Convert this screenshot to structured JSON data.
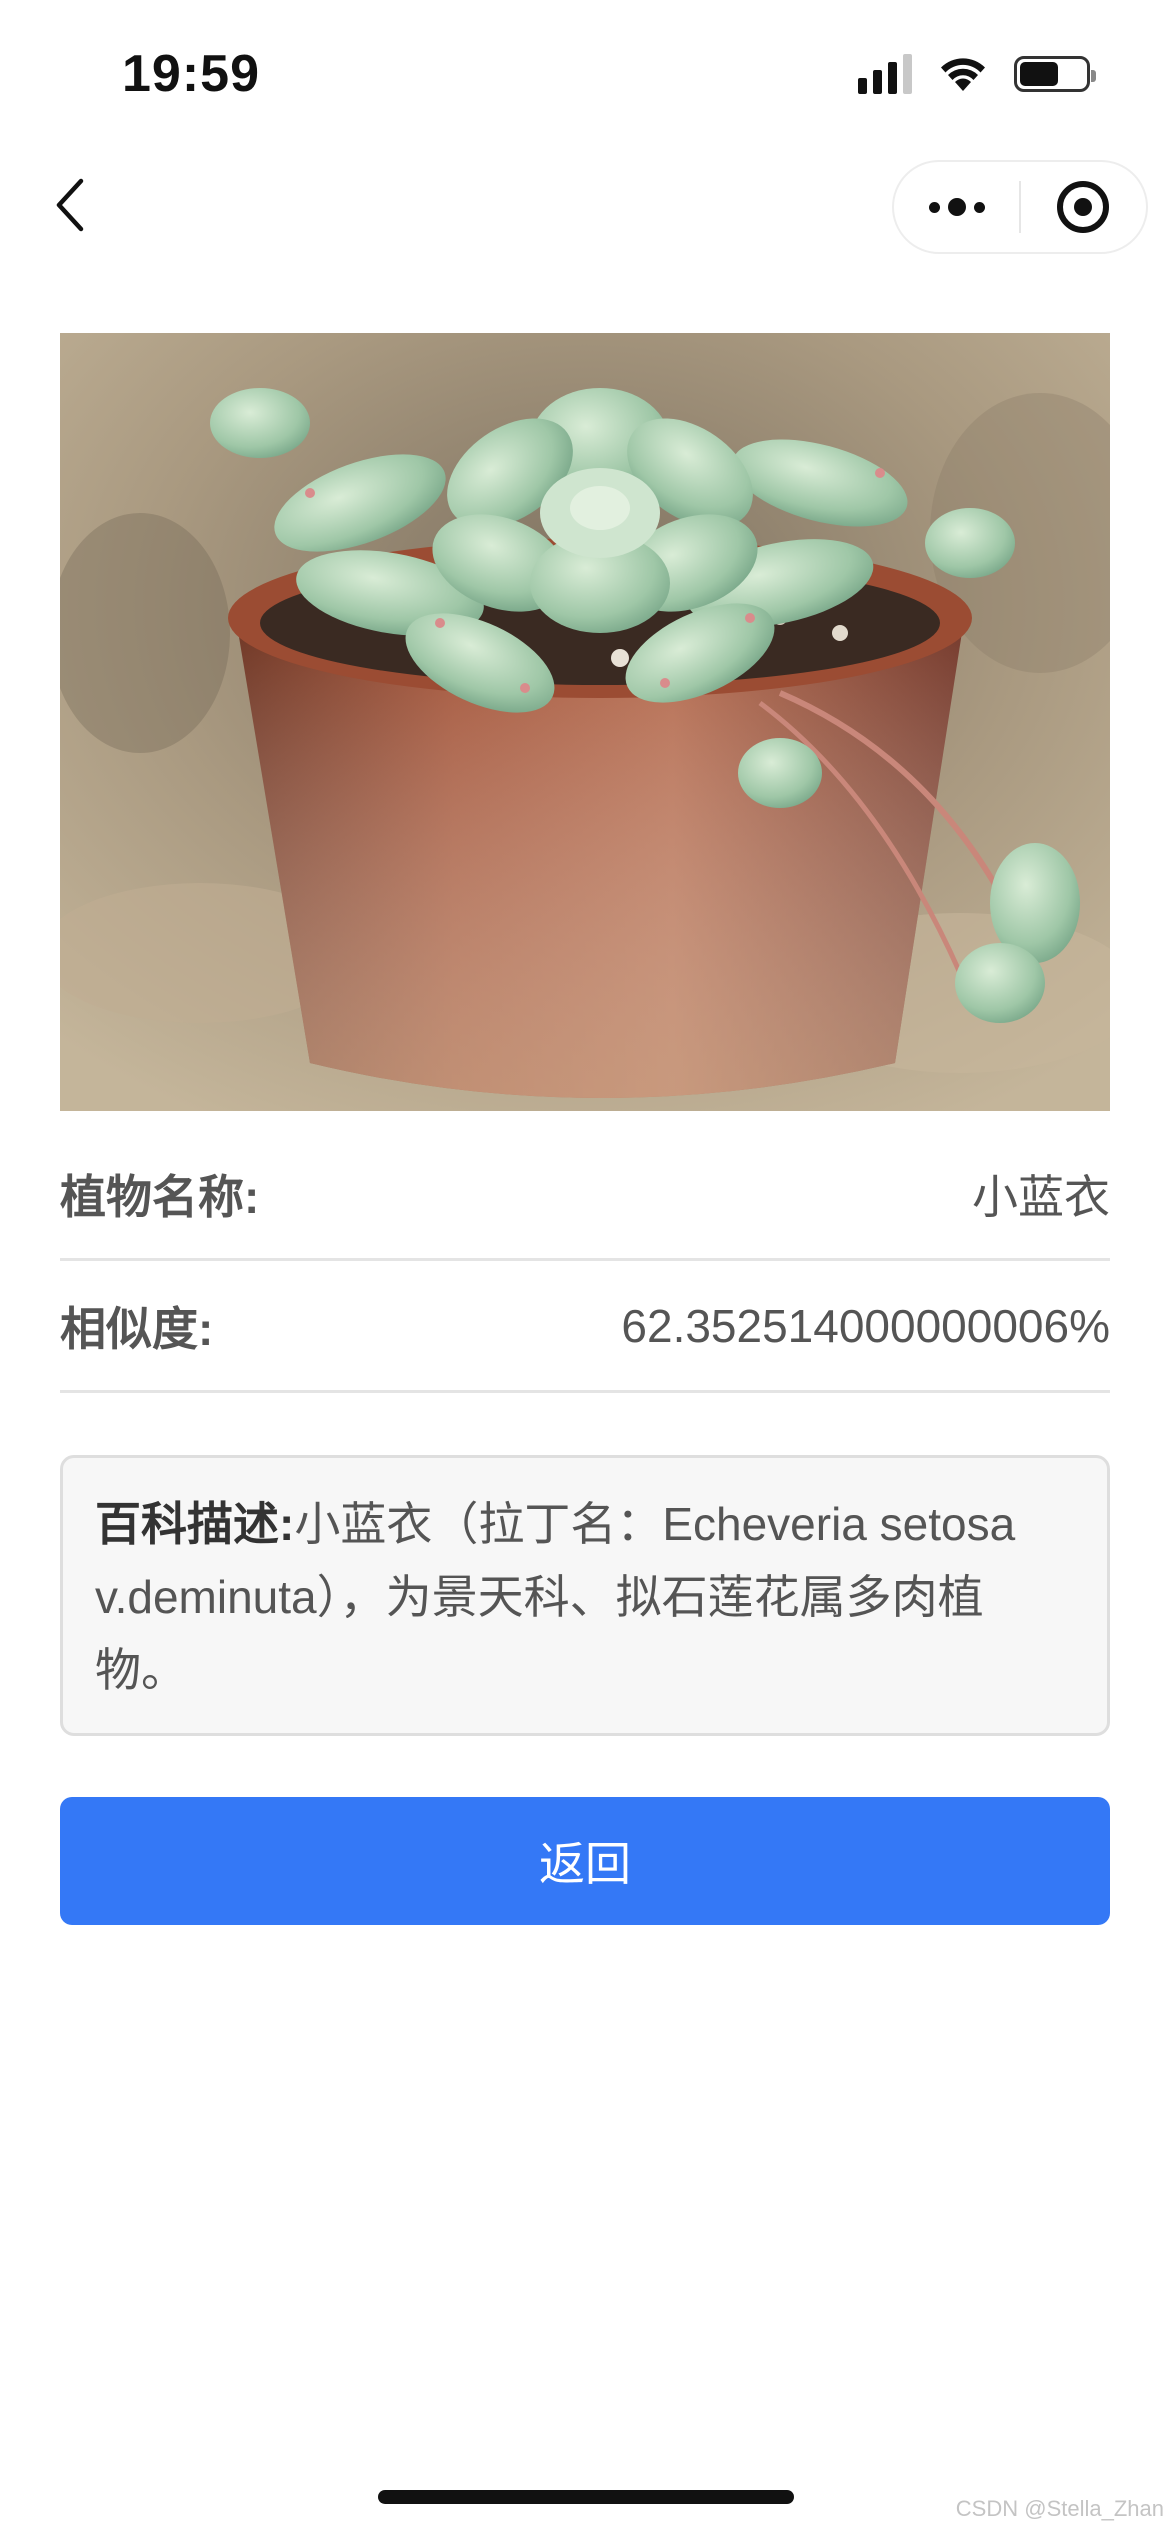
{
  "status_bar": {
    "time": "19:59",
    "icons": [
      "cellular-signal-icon",
      "wifi-icon",
      "battery-icon"
    ]
  },
  "nav": {
    "back_icon": "chevron-left-icon",
    "capsule_icons": [
      "more-dots-icon",
      "close-target-icon"
    ]
  },
  "photo": {
    "subject_icon": "succulent-photo"
  },
  "result": {
    "name_label": "植物名称:",
    "name_value": "小蓝衣",
    "similarity_label": "相似度:",
    "similarity_value": "62.352514000000006%"
  },
  "description": {
    "label": "百科描述:",
    "text": "小蓝衣（拉丁名：Echeveria setosa v.deminuta），为景天科、拟石莲花属多肉植物。"
  },
  "actions": {
    "return_label": "返回"
  },
  "watermark": "CSDN @Stella_Zhan",
  "colors": {
    "primary_button": "#3478f6",
    "divider": "#e4e4e4",
    "desc_background": "#f7f7f7"
  }
}
